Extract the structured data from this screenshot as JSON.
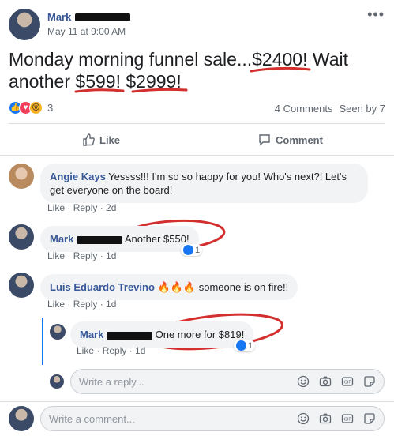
{
  "post": {
    "author_first": "Mark",
    "timestamp": "May 11 at 9:00 AM",
    "more_icon": "more-dots-icon",
    "text_line1_pre": "Monday morning funnel sale...",
    "text_line1_amount": "$2400",
    "text_line1_post": "! Wait",
    "text_line2_pre": "another ",
    "text_line2_amount1": "$599",
    "text_line2_mid": "! ",
    "text_line2_amount2": "$2999",
    "text_line2_post": "!",
    "reaction_count": "3",
    "comments_count": "4 Comments",
    "seen_by": "Seen by 7",
    "like_label": "Like",
    "comment_label": "Comment"
  },
  "comments": [
    {
      "author": "Angie Kays",
      "text": "Yessss!!! I'm so so happy for you! Who's next?! Let's get everyone on the board!",
      "like": "Like",
      "reply": "Reply",
      "time": "2d"
    },
    {
      "author": "Mark",
      "text": "Another $550!",
      "like": "Like",
      "reply": "Reply",
      "time": "1d",
      "reaction_count": "1"
    },
    {
      "author": "Luis Eduardo Trevino",
      "text": "someone is on fire!!",
      "emoji": "🔥🔥🔥",
      "like": "Like",
      "reply": "Reply",
      "time": "1d"
    }
  ],
  "reply": {
    "author": "Mark",
    "text": "One more for $819!",
    "like": "Like",
    "reply": "Reply",
    "time": "1d",
    "reaction_count": "1"
  },
  "reply_input": {
    "placeholder": "Write a reply..."
  },
  "comment_input": {
    "placeholder": "Write a comment..."
  },
  "colors": {
    "link": "#385898",
    "annotation_red": "#d32f2f",
    "bubble": "#f2f3f5"
  }
}
